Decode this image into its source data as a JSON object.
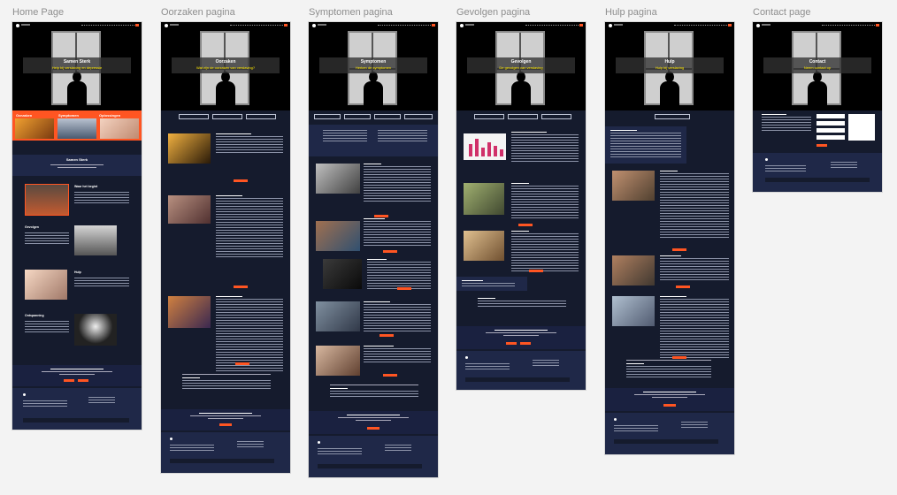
{
  "pages": [
    {
      "label": "Home Page",
      "hero_title": "Samen Sterk",
      "hero_subtitle": "Help bij verslaving en depressie"
    },
    {
      "label": "Oorzaken pagina",
      "hero_title": "Oorzaken",
      "hero_subtitle": "Wat zijn de oorzaken van verslaving?"
    },
    {
      "label": "Symptomen pagina",
      "hero_title": "Symptomen",
      "hero_subtitle": "Herken de symptomen"
    },
    {
      "label": "Gevolgen pagina",
      "hero_title": "Gevolgen",
      "hero_subtitle": "De gevolgen van verslaving"
    },
    {
      "label": "Hulp pagina",
      "hero_title": "Hulp",
      "hero_subtitle": "Hulp bij verslaving"
    },
    {
      "label": "Contact page",
      "hero_title": "Contact",
      "hero_subtitle": "Neem contact op"
    }
  ],
  "home": {
    "tabs": [
      "Oorzaken",
      "Symptomen",
      "Oplossingen"
    ],
    "intro_title": "Samen Sterk",
    "sections": [
      "Waar het begint",
      "Gevolgen",
      "Hulp",
      "Ontspanning"
    ]
  },
  "colors": {
    "accent": "#ff5522",
    "navy": "#151b2d",
    "panel": "#1f2848",
    "highlight": "#ffe800"
  }
}
